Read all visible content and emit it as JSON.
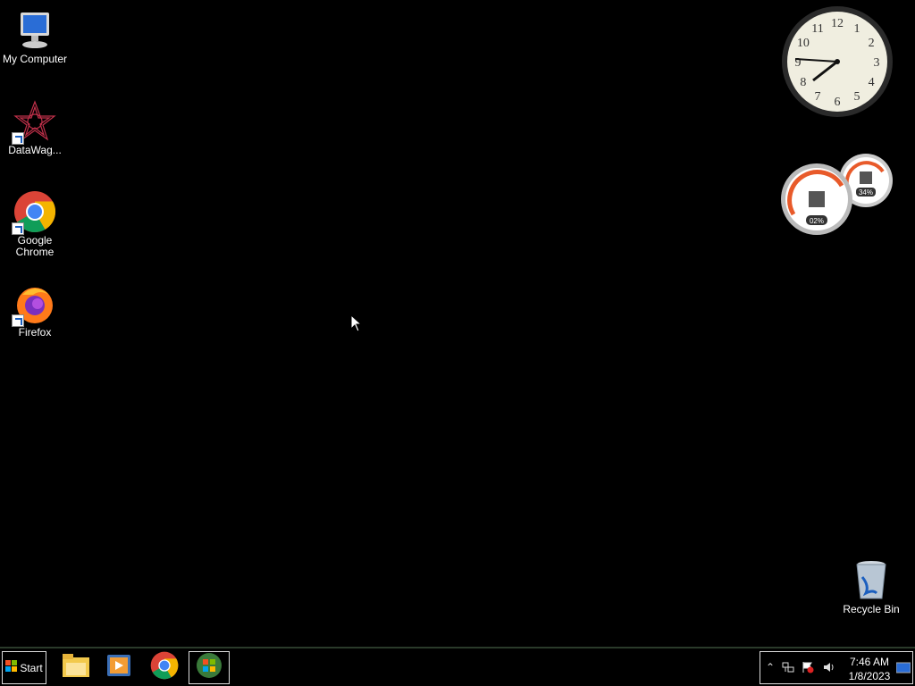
{
  "desktop": {
    "icons": [
      {
        "label": "My Computer",
        "icon": "computer-icon"
      },
      {
        "label": "DataWag...",
        "icon": "datawag-icon"
      },
      {
        "label": "Google Chrome",
        "icon": "chrome-icon"
      },
      {
        "label": "Firefox",
        "icon": "firefox-icon"
      },
      {
        "label": "Recycle Bin",
        "icon": "recycle-bin-icon"
      }
    ]
  },
  "gadgets": {
    "clock": {
      "numbers": [
        "12",
        "1",
        "2",
        "3",
        "4",
        "5",
        "6",
        "7",
        "8",
        "9",
        "10",
        "11"
      ],
      "time_shown": "7:46"
    },
    "meter": {
      "cpu_percent": "02%",
      "memory_percent": "34%"
    }
  },
  "taskbar": {
    "start_label": "Start",
    "pinned": [
      {
        "icon": "file-explorer-icon"
      },
      {
        "icon": "media-player-icon"
      },
      {
        "icon": "chrome-icon"
      },
      {
        "icon": "windows-icon"
      }
    ],
    "tray": {
      "time": "7:46 AM",
      "date": "1/8/2023"
    }
  },
  "colors": {
    "background": "#000000",
    "taskbar_border": "#dddddd"
  }
}
